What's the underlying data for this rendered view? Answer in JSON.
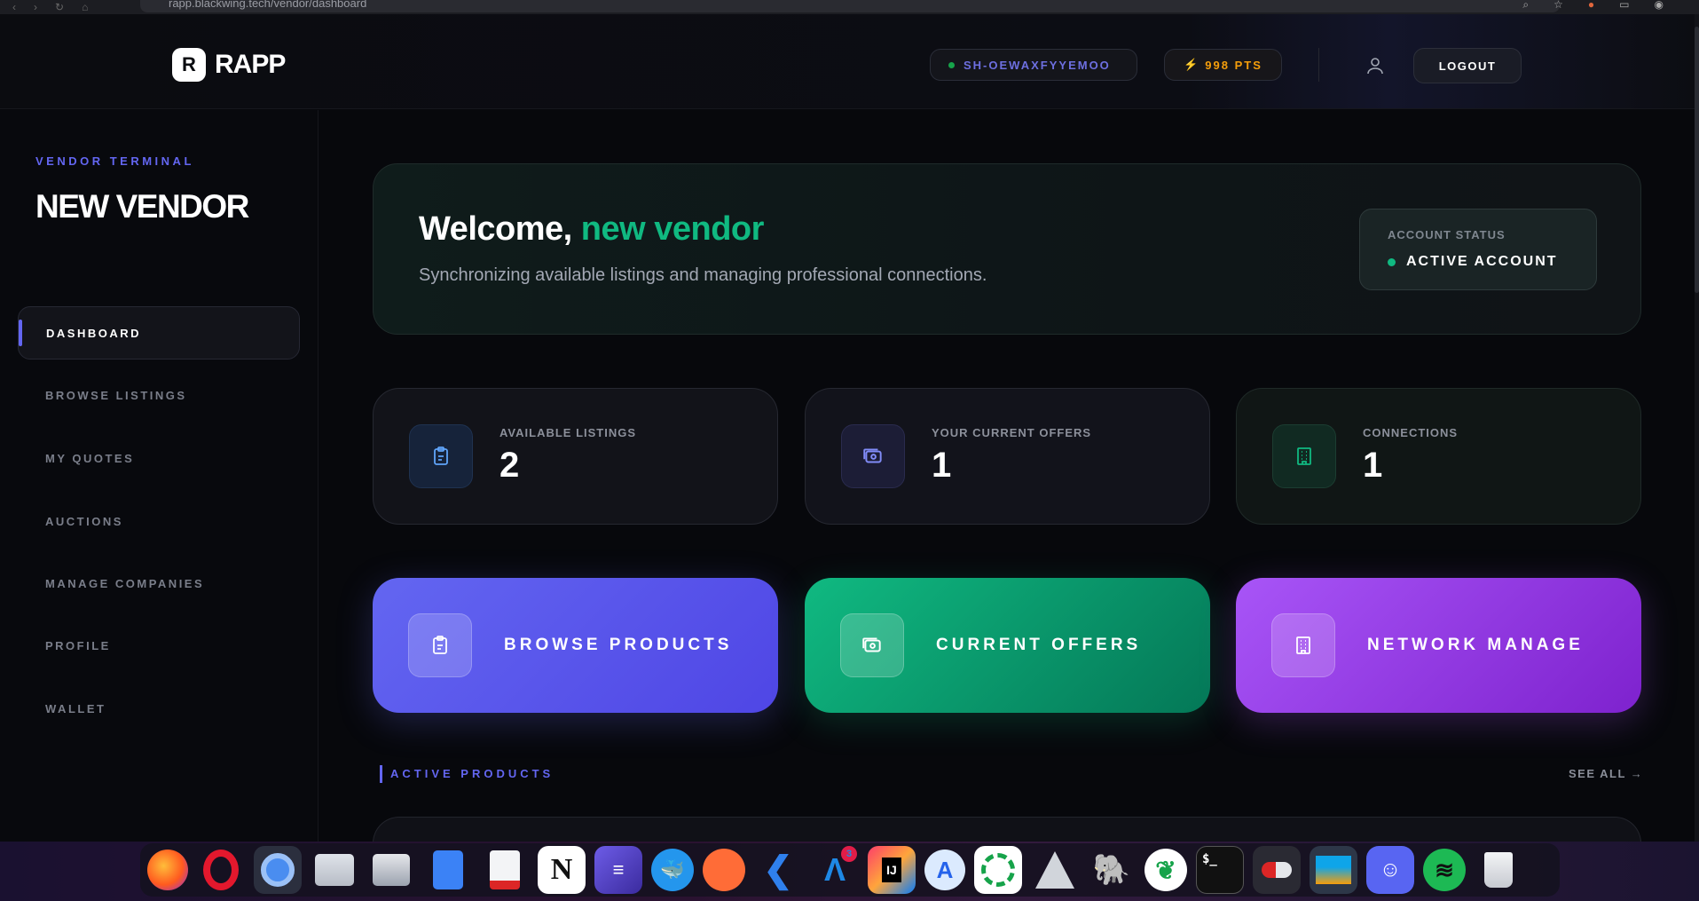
{
  "browser": {
    "url": "rapp.blackwing.tech/vendor/dashboard"
  },
  "header": {
    "logo_mark": "R",
    "logo_text": "RAPP",
    "session_id": "SH-OEWAXFYYEMOO",
    "points": "998 PTS",
    "logout_label": "LOGOUT"
  },
  "sidebar": {
    "eyebrow": "VENDOR TERMINAL",
    "title": "NEW VENDOR",
    "items": [
      {
        "label": "DASHBOARD",
        "active": true
      },
      {
        "label": "BROWSE LISTINGS"
      },
      {
        "label": "MY QUOTES"
      },
      {
        "label": "AUCTIONS"
      },
      {
        "label": "MANAGE COMPANIES"
      },
      {
        "label": "PROFILE"
      },
      {
        "label": "WALLET"
      }
    ]
  },
  "welcome": {
    "greeting": "Welcome, ",
    "name": "new vendor",
    "subtitle": "Synchronizing available listings and managing professional connections.",
    "status_label": "ACCOUNT STATUS",
    "status_value": "ACTIVE ACCOUNT"
  },
  "stats": [
    {
      "label": "AVAILABLE LISTINGS",
      "value": "2",
      "icon": "clipboard-icon",
      "color": "#60a5fa"
    },
    {
      "label": "YOUR CURRENT OFFERS",
      "value": "1",
      "icon": "cash-icon",
      "color": "#818cf8"
    },
    {
      "label": "CONNECTIONS",
      "value": "1",
      "icon": "building-icon",
      "color": "#10b981"
    }
  ],
  "actions": [
    {
      "label": "BROWSE PRODUCTS",
      "icon": "clipboard-icon"
    },
    {
      "label": "CURRENT OFFERS",
      "icon": "cash-icon"
    },
    {
      "label": "NETWORK MANAGE",
      "icon": "building-icon"
    }
  ],
  "section": {
    "title": "ACTIVE PRODUCTS",
    "see_all": "SEE ALL →"
  },
  "dock": {
    "apps": [
      "firefox-icon",
      "opera-icon",
      "chromium-icon",
      "files-icon",
      "archive-icon",
      "docs-icon",
      "text-editor-icon",
      "notion-icon",
      "editor-icon",
      "docker-icon",
      "postman-icon",
      "vscode-icon",
      "arduino-icon",
      "intellij-icon",
      "app-store-icon",
      "sync-icon",
      "3d-icon",
      "tableplus-icon",
      "mongodb-icon",
      "terminal-icon",
      "toggle-icon",
      "monitor-icon",
      "discord-icon",
      "spotify-icon",
      "trash-icon"
    ],
    "badge": "3",
    "notion_letter": "N",
    "terminal_text": "$_",
    "intellij_text": "IJ"
  }
}
